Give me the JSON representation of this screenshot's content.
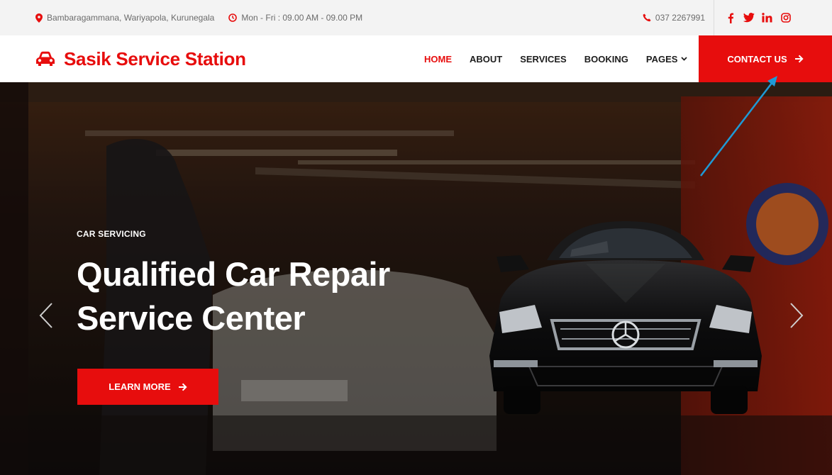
{
  "topbar": {
    "address": "Bambaragammana, Wariyapola, Kurunegala",
    "hours": "Mon - Fri : 09.00 AM - 09.00 PM",
    "phone": "037 2267991",
    "social": [
      {
        "name": "facebook-icon",
        "glyph": "f"
      },
      {
        "name": "twitter-icon",
        "glyph": "t"
      },
      {
        "name": "linkedin-icon",
        "glyph": "in"
      },
      {
        "name": "instagram-icon",
        "glyph": "ig"
      }
    ]
  },
  "brand": {
    "name": "Sasik Service Station"
  },
  "nav": {
    "items": [
      {
        "label": "HOME",
        "active": true
      },
      {
        "label": "ABOUT"
      },
      {
        "label": "SERVICES"
      },
      {
        "label": "BOOKING"
      },
      {
        "label": "PAGES"
      }
    ],
    "contact_label": "CONTACT US"
  },
  "hero": {
    "kicker": "CAR SERVICING",
    "headline_line1": "Qualified Car Repair",
    "headline_line2": "Service Center",
    "cta_label": "LEARN MORE"
  },
  "colors": {
    "brand_red": "#e70d0d",
    "topbar_bg": "#f3f3f3",
    "annotation_arrow": "#1e9ad6"
  }
}
